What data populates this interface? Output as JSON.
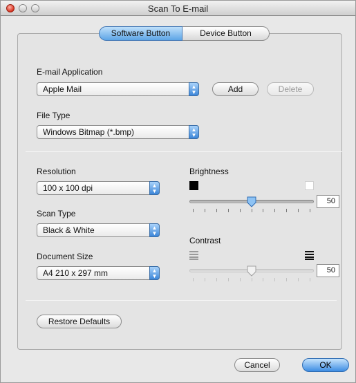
{
  "window": {
    "title": "Scan To E-mail"
  },
  "tabs": {
    "software": "Software Button",
    "device": "Device Button"
  },
  "email": {
    "label": "E-mail Application",
    "selected": "Apple Mail",
    "add": "Add",
    "delete": "Delete"
  },
  "filetype": {
    "label": "File Type",
    "selected": "Windows Bitmap (*.bmp)"
  },
  "resolution": {
    "label": "Resolution",
    "selected": "100 x 100 dpi"
  },
  "scantype": {
    "label": "Scan Type",
    "selected": "Black & White"
  },
  "docsize": {
    "label": "Document Size",
    "selected": "A4 210 x 297 mm"
  },
  "brightness": {
    "label": "Brightness",
    "value": "50",
    "level": 0.5
  },
  "contrast": {
    "label": "Contrast",
    "value": "50",
    "level": 0.5
  },
  "buttons": {
    "restore": "Restore Defaults",
    "cancel": "Cancel",
    "ok": "OK"
  },
  "colors": {
    "accent": "#5da5e6",
    "default_button": "#3d8de3"
  },
  "icons": {
    "brightness_low": "black-square-icon",
    "brightness_high": "white-square-icon",
    "contrast_low": "low-contrast-lines-icon",
    "contrast_high": "high-contrast-lines-icon"
  }
}
